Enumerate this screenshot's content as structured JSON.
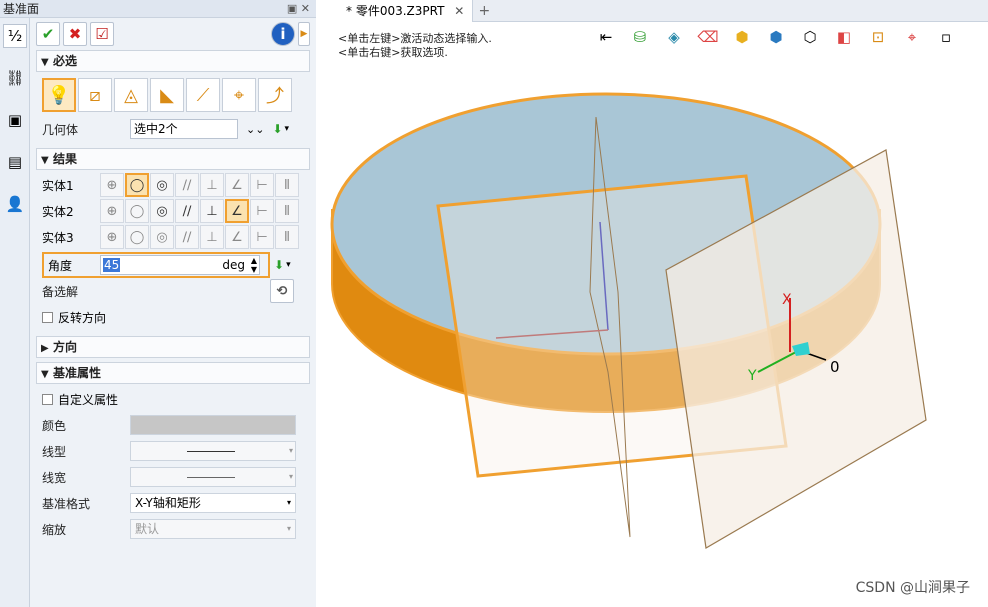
{
  "panel": {
    "title": "基准面",
    "window_controls": "▣ ✕",
    "toolbar": {
      "ok": "✔",
      "cancel": "✖",
      "apply": "☑",
      "info": "i",
      "expand": "▶"
    },
    "sections": {
      "required": "必选",
      "result": "结果",
      "direction": "方向",
      "datum_props": "基准属性"
    },
    "geometry_label": "几何体",
    "geometry_value": "选中2个",
    "entities": [
      "实体1",
      "实体2",
      "实体3"
    ],
    "angle_label": "角度",
    "angle_value": "45",
    "angle_unit": "deg",
    "alt_solution_label": "备选解",
    "reverse_label": "反转方向",
    "custom_props_label": "自定义属性",
    "color_label": "颜色",
    "linetype_label": "线型",
    "linewidth_label": "线宽",
    "datum_style_label": "基准格式",
    "datum_style_value": "X-Y轴和矩形",
    "scale_label": "缩放",
    "scale_value": "默认"
  },
  "canvas": {
    "tab_title": "* 零件003.Z3PRT",
    "tab_close": "✕",
    "tab_add": "+",
    "hint_left": "<单击左键>激活动态选择输入.",
    "hint_right": "<单击右键>获取选项.",
    "axis_x": "X",
    "axis_y": "Y",
    "origin_label": "0",
    "watermark": "CSDN @山涧果子"
  },
  "colors": {
    "accent_orange": "#f0a030",
    "cylinder_side": "#e08a10",
    "cylinder_top": "#a9c6d6",
    "plane_fill": "#f6ede4"
  }
}
